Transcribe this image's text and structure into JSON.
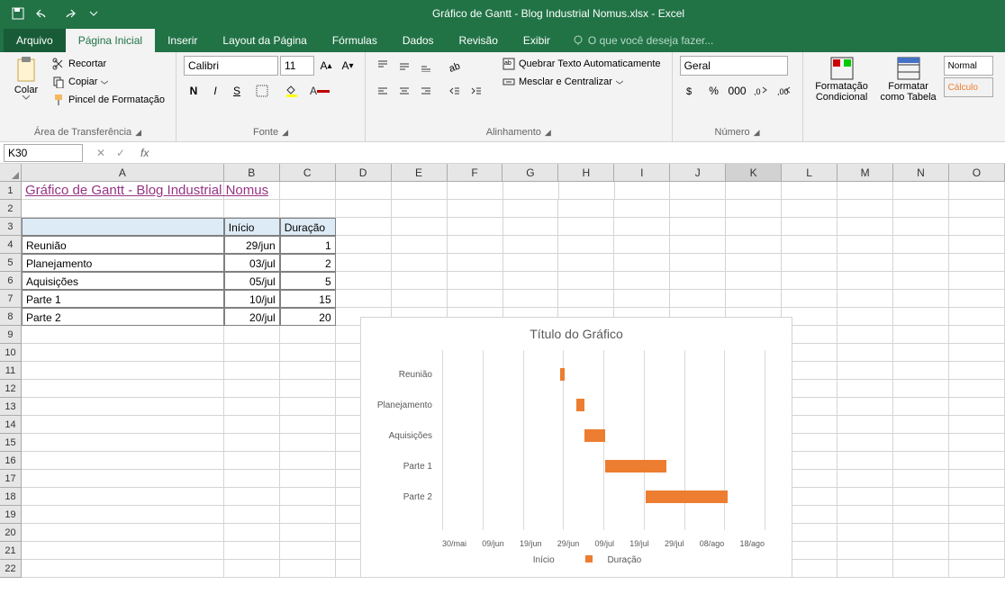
{
  "titlebar": {
    "title": "Gráfico de Gantt - Blog Industrial Nomus.xlsx - Excel"
  },
  "tabs": {
    "file": "Arquivo",
    "home": "Página Inicial",
    "insert": "Inserir",
    "layout": "Layout da Página",
    "formulas": "Fórmulas",
    "data": "Dados",
    "review": "Revisão",
    "view": "Exibir",
    "tellme": "O que você deseja fazer..."
  },
  "ribbon": {
    "clipboard": {
      "paste": "Colar",
      "cut": "Recortar",
      "copy": "Copiar",
      "painter": "Pincel de Formatação",
      "label": "Área de Transferência"
    },
    "font": {
      "name": "Calibri",
      "size": "11",
      "label": "Fonte"
    },
    "alignment": {
      "wrap": "Quebrar Texto Automaticamente",
      "merge": "Mesclar e Centralizar",
      "label": "Alinhamento"
    },
    "number": {
      "format": "Geral",
      "label": "Número"
    },
    "styles": {
      "conditional": "Formatação Condicional",
      "table": "Formatar como Tabela",
      "normal": "Normal",
      "calc": "Cálculo"
    }
  },
  "namebox": "K30",
  "columns": [
    "A",
    "B",
    "C",
    "D",
    "E",
    "F",
    "G",
    "H",
    "I",
    "J",
    "K",
    "L",
    "M",
    "N",
    "O"
  ],
  "sheet": {
    "title_link": "Gráfico de Gantt - Blog Industrial Nomus",
    "header_inicio": "Início",
    "header_duracao": "Duração",
    "rows": [
      {
        "task": "Reunião",
        "start": "29/jun",
        "dur": "1"
      },
      {
        "task": "Planejamento",
        "start": "03/jul",
        "dur": "2"
      },
      {
        "task": "Aquisições",
        "start": "05/jul",
        "dur": "5"
      },
      {
        "task": "Parte 1",
        "start": "10/jul",
        "dur": "15"
      },
      {
        "task": "Parte 2",
        "start": "20/jul",
        "dur": "20"
      }
    ]
  },
  "chart_data": {
    "type": "bar",
    "title": "Título do Gráfico",
    "categories": [
      "Reunião",
      "Planejamento",
      "Aquisições",
      "Parte 1",
      "Parte 2"
    ],
    "series": [
      {
        "name": "Início",
        "values": [
          "29/jun",
          "03/jul",
          "05/jul",
          "10/jul",
          "20/jul"
        ]
      },
      {
        "name": "Duração",
        "values": [
          1,
          2,
          5,
          15,
          20
        ]
      }
    ],
    "x_axis_ticks": [
      "30/mai",
      "09/jun",
      "19/jun",
      "29/jun",
      "09/jul",
      "19/jul",
      "29/jul",
      "08/ago",
      "18/ago"
    ],
    "legend": [
      "Início",
      "Duração"
    ]
  }
}
